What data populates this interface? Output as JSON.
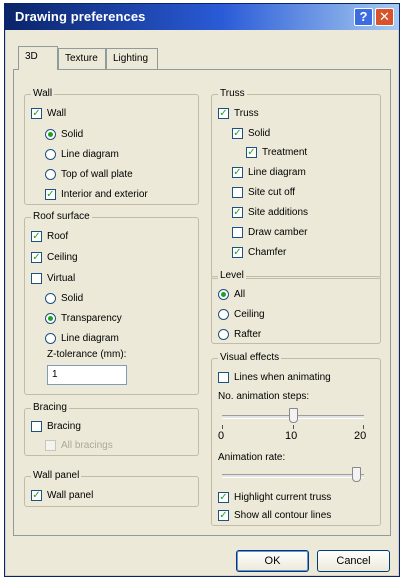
{
  "window": {
    "title": "Drawing preferences",
    "help_glyph": "?",
    "close_glyph": "✕"
  },
  "tabs": [
    "3D",
    "Texture",
    "Lighting"
  ],
  "wall": {
    "title": "Wall",
    "wall_checkbox": {
      "label": "Wall",
      "checked": true
    },
    "options": [
      {
        "label": "Solid",
        "selected": true
      },
      {
        "label": "Line diagram",
        "selected": false
      },
      {
        "label": "Top of wall plate",
        "selected": false
      }
    ],
    "interior_exterior": {
      "label": "Interior and exterior",
      "checked": true
    }
  },
  "roof_surface": {
    "title": "Roof surface",
    "roof": {
      "label": "Roof",
      "checked": true
    },
    "ceiling": {
      "label": "Ceiling",
      "checked": true
    },
    "virtual": {
      "label": "Virtual",
      "checked": false
    },
    "options": [
      {
        "label": "Solid",
        "selected": false
      },
      {
        "label": "Transparency",
        "selected": true
      },
      {
        "label": "Line diagram",
        "selected": false
      }
    ],
    "z_tolerance_label": "Z-tolerance (mm):",
    "z_tolerance_value": "1"
  },
  "bracing": {
    "title": "Bracing",
    "bracing": {
      "label": "Bracing",
      "checked": false
    },
    "all_bracings": {
      "label": "All bracings",
      "checked": false,
      "disabled": true
    }
  },
  "wall_panel": {
    "title": "Wall panel",
    "wall_panel": {
      "label": "Wall panel",
      "checked": true
    }
  },
  "truss": {
    "title": "Truss",
    "truss": {
      "label": "Truss",
      "checked": true
    },
    "solid": {
      "label": "Solid",
      "checked": true
    },
    "treatment": {
      "label": "Treatment",
      "checked": true
    },
    "line_diagram": {
      "label": "Line diagram",
      "checked": true
    },
    "site_cut_off": {
      "label": "Site cut off",
      "checked": false
    },
    "site_additions": {
      "label": "Site additions",
      "checked": true
    },
    "draw_camber": {
      "label": "Draw camber",
      "checked": false
    },
    "chamfer": {
      "label": "Chamfer",
      "checked": true
    }
  },
  "level": {
    "title": "Level",
    "options": [
      {
        "label": "All",
        "selected": true
      },
      {
        "label": "Ceiling",
        "selected": false
      },
      {
        "label": "Rafter",
        "selected": false
      }
    ]
  },
  "visual_effects": {
    "title": "Visual effects",
    "lines_when_animating": {
      "label": "Lines when animating",
      "checked": false
    },
    "animation_steps_label": "No. animation steps:",
    "animation_steps_value": 10,
    "animation_steps_ticks": [
      "0",
      "10",
      "20"
    ],
    "animation_rate_label": "Animation rate:",
    "animation_rate_fraction": 0.95,
    "highlight_current_truss": {
      "label": "Highlight current truss",
      "checked": true
    },
    "show_all_contour_lines": {
      "label": "Show all contour lines",
      "checked": true
    }
  },
  "buttons": {
    "ok": "OK",
    "cancel": "Cancel"
  },
  "colors": {
    "title_bar": "#0a246a",
    "check_mark": "#21a121",
    "dialog_bg": "#ece9d8"
  }
}
